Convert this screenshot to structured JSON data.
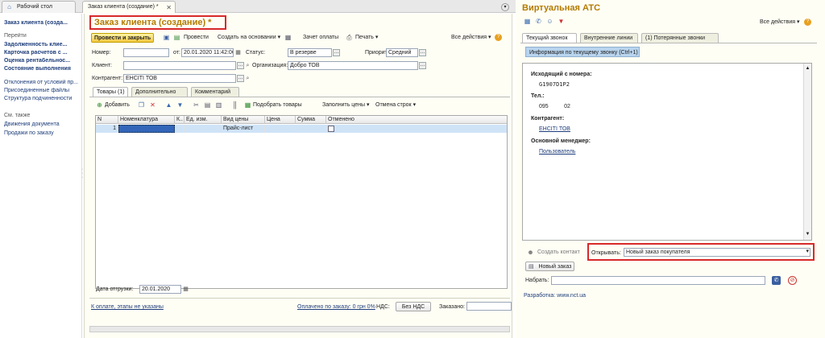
{
  "tabs": {
    "desktop": "Рабочий стол",
    "order": "Заказ клиента (создание) *"
  },
  "sidebar": {
    "title": "Заказ клиента (созда...",
    "goto": "Перейти",
    "nav": [
      "Задолженность клие...",
      "Карточка расчетов с ...",
      "Оценка рентабельнос...",
      "Состояние выполнения"
    ],
    "links": [
      "Отклонения от условий пр...",
      "Присоединенные файлы",
      "Структура подчиненности"
    ],
    "see_also": "См. также",
    "see_also_items": [
      "Движения документа",
      "Продажи по заказу"
    ]
  },
  "order": {
    "title": "Заказ клиента (создание) *",
    "toolbar": {
      "post_close": "Провести и закрыть",
      "post": "Провести",
      "create_based": "Создать на основании",
      "payment_offset": "Зачет оплаты",
      "print": "Печать",
      "all_actions": "Все действия"
    },
    "fields": {
      "number_label": "Номер:",
      "number_value": "",
      "date_label": "от:",
      "date_value": "20.01.2020 11:42:06",
      "status_label": "Статус:",
      "status_value": "В резерве",
      "priority_label": "Приоритет:",
      "priority_value": "Средний",
      "client_label": "Клиент:",
      "client_value": "",
      "org_label": "Организация:",
      "org_value": "Добро ТОВ",
      "counterparty_label": "Контрагент:",
      "counterparty_value": "ЕНСІТІ ТОВ"
    },
    "subtabs": [
      "Товары (1)",
      "Дополнительно",
      "Комментарий"
    ],
    "grid_toolbar": {
      "add": "Добавить",
      "pick": "Подобрать товары",
      "fill_prices": "Заполнить цены",
      "cancel_rows": "Отмена строк"
    },
    "columns": [
      "N",
      "Номенклатура",
      "К..",
      "Ед. изм.",
      "Вид цены",
      "Цена",
      "Сумма",
      "Отменено"
    ],
    "rows": [
      {
        "n": "1",
        "item": "",
        "k": "",
        "unit": "",
        "price_type": "Прайс-лист",
        "price": "",
        "sum": "",
        "cancelled": ""
      }
    ],
    "ship_date_label": "Дата отгрузки:",
    "ship_date_value": "20.01.2020",
    "footer": {
      "payment_link": "К оплате, этапы не указаны",
      "paid_link": "Оплачено по заказу: 0 грн  0%",
      "vat_label": "НДС:",
      "vat_button": "Без НДС",
      "ordered_label": "Заказано:"
    }
  },
  "atc": {
    "title": "Виртуальная АТС",
    "all_actions": "Все действия",
    "tabs": [
      "Текущий звонок",
      "Внутренние линии",
      "(1) Потерянные звонки"
    ],
    "info_tab": "Информация по текущему звонку (Ctrl+1)",
    "from_label": "Исходящий с номера:",
    "from_value": "G1907D1P2",
    "tel_label": "Тел.:",
    "tel_value": "095          02",
    "counterparty_label": "Контрагент:",
    "counterparty_value": "ЕНСІТІ ТОВ",
    "manager_label": "Основной менеджер:",
    "manager_value": "Пользователь",
    "create_contact": "Создать контакт",
    "open_label": "Открывать:",
    "open_value": "Новый заказ покупателя",
    "new_order": "Новый заказ",
    "dial_label": "Набрать:",
    "dial_value": "",
    "developer": "Разработка: www.nct.ua"
  }
}
